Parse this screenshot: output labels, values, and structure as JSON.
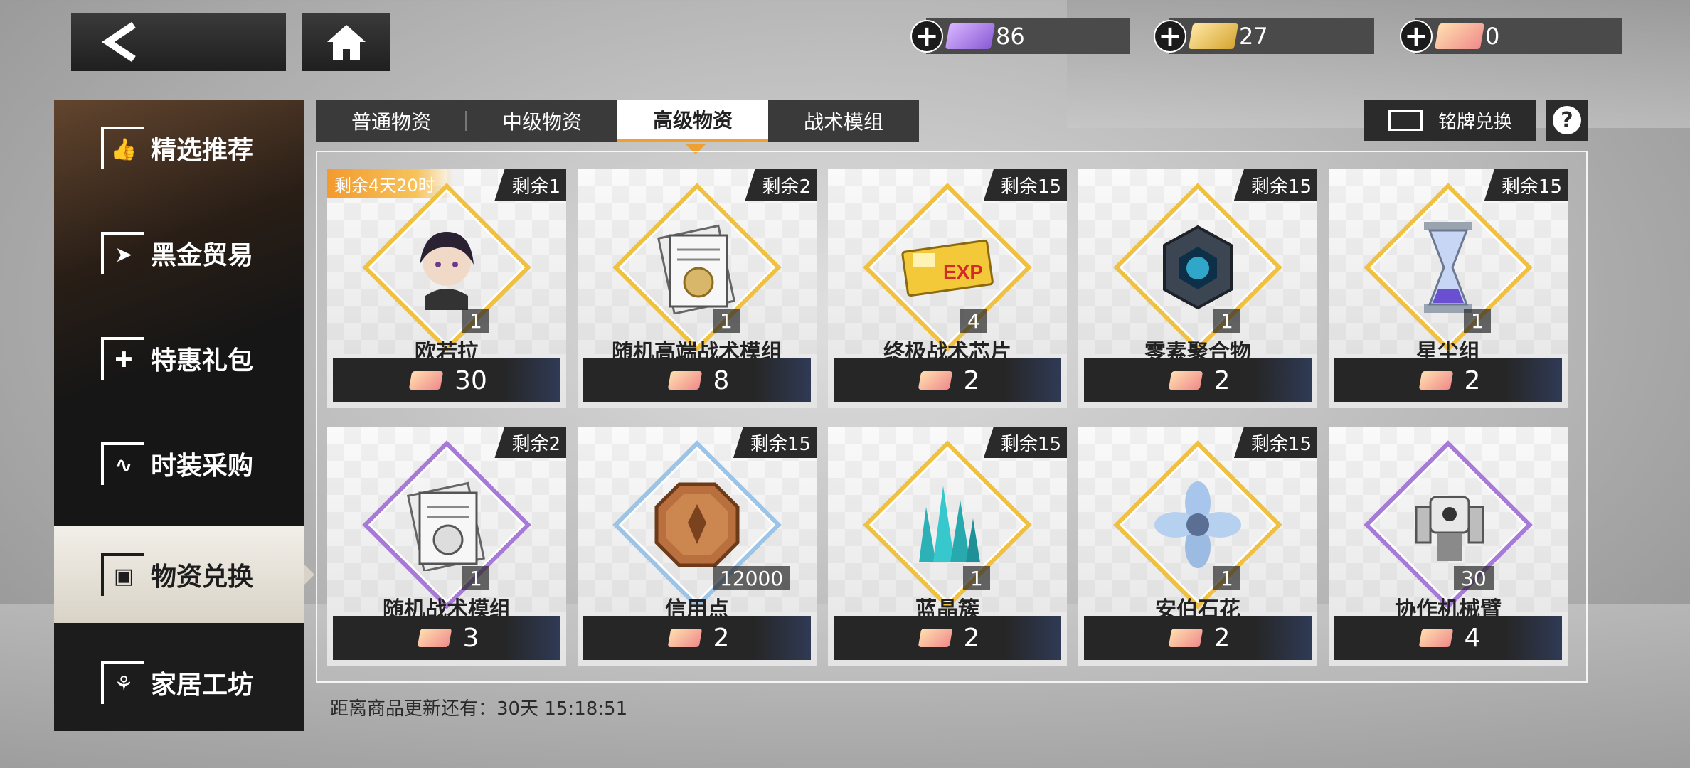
{
  "currencies": [
    {
      "value": "86",
      "color": "purple"
    },
    {
      "value": "27",
      "color": "gold"
    },
    {
      "value": "0",
      "color": "pink"
    }
  ],
  "sidebar": {
    "items": [
      {
        "label": "精选推荐",
        "icon": "thumb-up-icon"
      },
      {
        "label": "黑金贸易",
        "icon": "paper-plane-icon"
      },
      {
        "label": "特惠礼包",
        "icon": "gift-icon"
      },
      {
        "label": "时装采购",
        "icon": "hanger-icon"
      },
      {
        "label": "物资兑换",
        "icon": "box-icon"
      },
      {
        "label": "家居工坊",
        "icon": "plant-icon"
      }
    ]
  },
  "tabs": [
    {
      "label": "普通物资"
    },
    {
      "label": "中级物资"
    },
    {
      "label": "高级物资"
    },
    {
      "label": "战术模组"
    }
  ],
  "exchange_label": "铭牌兑换",
  "items": [
    {
      "name": "欧若拉",
      "stock": "剩余1",
      "qty": "1",
      "price": "30",
      "timer": "剩余4天20时",
      "frame": "gold"
    },
    {
      "name": "随机高端战术模组",
      "stock": "剩余2",
      "qty": "1",
      "price": "8",
      "frame": "gold"
    },
    {
      "name": "终极战术芯片",
      "stock": "剩余15",
      "qty": "4",
      "price": "2",
      "frame": "gold"
    },
    {
      "name": "零素聚合物",
      "stock": "剩余15",
      "qty": "1",
      "price": "2",
      "frame": "gold"
    },
    {
      "name": "星尘组",
      "stock": "剩余15",
      "qty": "1",
      "price": "2",
      "frame": "gold"
    },
    {
      "name": "随机战术模组",
      "stock": "剩余2",
      "qty": "1",
      "price": "3",
      "frame": "purple"
    },
    {
      "name": "信用点",
      "stock": "剩余15",
      "qty": "12000",
      "price": "2",
      "frame": "blue"
    },
    {
      "name": "蓝晶簇",
      "stock": "剩余15",
      "qty": "1",
      "price": "2",
      "frame": "gold"
    },
    {
      "name": "安伯石花",
      "stock": "剩余15",
      "qty": "1",
      "price": "2",
      "frame": "gold"
    },
    {
      "name": "协作机械臂",
      "stock": "",
      "qty": "30",
      "price": "4",
      "frame": "purple"
    }
  ],
  "refresh_text": "距离商品更新还有：30天 15:18:51"
}
